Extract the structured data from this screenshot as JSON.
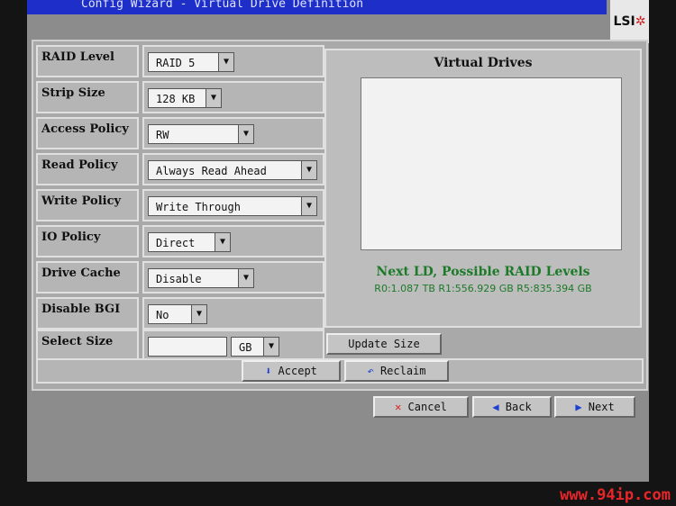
{
  "window": {
    "title": "Config Wizard - Virtual Drive Definition",
    "logo": "LSI"
  },
  "fields": [
    {
      "label": "RAID Level",
      "value": "RAID 5"
    },
    {
      "label": "Strip Size",
      "value": "128 KB"
    },
    {
      "label": "Access Policy",
      "value": "RW"
    },
    {
      "label": "Read Policy",
      "value": "Always Read Ahead"
    },
    {
      "label": "Write Policy",
      "value": "Write Through"
    },
    {
      "label": "IO Policy",
      "value": "Direct"
    },
    {
      "label": "Drive Cache",
      "value": "Disable"
    },
    {
      "label": "Disable BGI",
      "value": "No"
    }
  ],
  "select_size": {
    "label": "Select Size",
    "value": "",
    "unit": "GB"
  },
  "virtual_drives": {
    "title": "Virtual Drives",
    "next_title": "Next LD, Possible RAID Levels",
    "next_levels": "R0:1.087 TB  R1:556.929 GB  R5:835.394 GB"
  },
  "buttons": {
    "update_size": "Update Size",
    "accept": "Accept",
    "reclaim": "Reclaim",
    "cancel": "Cancel",
    "back": "Back",
    "next": "Next"
  },
  "watermark": "www.94ip.com",
  "colors": {
    "title_bar": "#1d2fc8",
    "green_text": "#1c7a28"
  }
}
